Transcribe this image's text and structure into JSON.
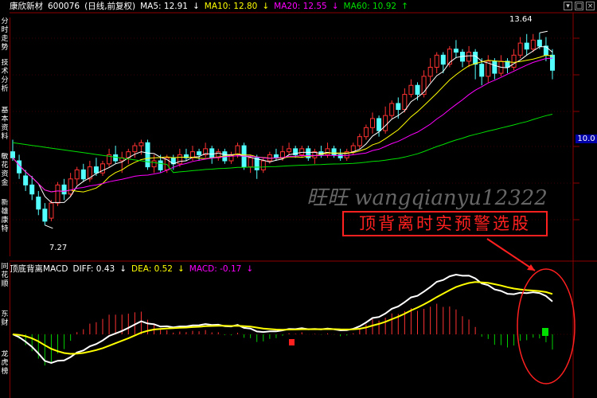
{
  "main_header": {
    "name": "康欣新材",
    "code": "600076",
    "period": "(日线,前复权)",
    "ma5": "MA5: 12.91",
    "ma10": "MA10: 12.80",
    "ma20": "MA20: 12.55",
    "ma60": "MA60: 10.92"
  },
  "macd_header": {
    "title": "顶底背离MACD",
    "diff": "DIFF: 0.43",
    "dea": "DEA: 0.52",
    "macd": "MACD: -0.17"
  },
  "left_tabs": [
    "分时走势",
    "技术分析",
    "基本资料",
    "敏花资金",
    "新雄康特"
  ],
  "left_tabs_lower": [
    "同花顺",
    "东财",
    "龙虎榜"
  ],
  "watermark": "旺旺 wangqianyu12322",
  "annotation": "顶背离时实预警选股",
  "price_labels": {
    "high": "13.64",
    "low": "7.27",
    "current": "10.0"
  },
  "colors": {
    "up": "#ff3232",
    "down": "#54ffff",
    "ma5": "#ffffff",
    "ma10": "#ffff00",
    "ma20": "#ff00ff",
    "ma60": "#00e000",
    "grid": "#8b0000",
    "annotation": "#ff2020"
  },
  "chart_data": {
    "type": "candlestick",
    "ylim": [
      6.5,
      14.2
    ],
    "candles": [
      [
        9.7,
        9.5,
        10.1,
        9.4
      ],
      [
        9.4,
        9.0,
        9.6,
        8.8
      ],
      [
        8.9,
        8.6,
        9.1,
        8.4
      ],
      [
        8.6,
        8.3,
        8.9,
        8.1
      ],
      [
        8.2,
        7.8,
        8.4,
        7.6
      ],
      [
        7.8,
        7.4,
        8.0,
        7.27
      ],
      [
        7.5,
        8.0,
        8.1,
        7.4
      ],
      [
        8.0,
        8.6,
        8.7,
        7.9
      ],
      [
        8.6,
        8.3,
        8.8,
        8.1
      ],
      [
        8.3,
        8.8,
        9.0,
        8.2
      ],
      [
        8.8,
        9.1,
        9.2,
        8.6
      ],
      [
        9.1,
        8.8,
        9.3,
        8.7
      ],
      [
        8.8,
        9.2,
        9.4,
        8.7
      ],
      [
        9.2,
        9.0,
        9.5,
        8.9
      ],
      [
        9.0,
        9.3,
        9.4,
        8.9
      ],
      [
        9.3,
        9.6,
        9.8,
        9.2
      ],
      [
        9.6,
        9.4,
        9.9,
        9.3
      ],
      [
        9.4,
        9.5,
        9.7,
        9.0
      ],
      [
        9.5,
        9.7,
        9.8,
        9.3
      ],
      [
        9.7,
        9.9,
        10.0,
        9.5
      ],
      [
        9.9,
        10.0,
        10.1,
        9.6
      ],
      [
        10.0,
        9.2,
        10.1,
        9.1
      ],
      [
        9.2,
        9.4,
        9.6,
        9.0
      ],
      [
        9.4,
        9.1,
        9.6,
        9.0
      ],
      [
        9.1,
        9.5,
        9.6,
        9.0
      ],
      [
        9.5,
        9.3,
        9.6,
        9.1
      ],
      [
        9.3,
        9.6,
        9.8,
        9.2
      ],
      [
        9.6,
        9.5,
        9.8,
        9.4
      ],
      [
        9.5,
        9.7,
        9.9,
        9.4
      ],
      [
        9.7,
        9.6,
        9.8,
        9.4
      ],
      [
        9.6,
        9.8,
        10.0,
        9.5
      ],
      [
        9.8,
        9.5,
        9.9,
        9.3
      ],
      [
        9.5,
        9.7,
        9.8,
        9.4
      ],
      [
        9.7,
        9.4,
        9.8,
        9.3
      ],
      [
        9.4,
        9.6,
        9.7,
        9.3
      ],
      [
        9.6,
        9.9,
        10.0,
        9.5
      ],
      [
        9.9,
        9.2,
        10.0,
        9.1
      ],
      [
        9.2,
        9.5,
        9.6,
        9.0
      ],
      [
        9.5,
        9.1,
        9.6,
        8.8
      ],
      [
        9.1,
        9.4,
        9.5,
        9.0
      ],
      [
        9.4,
        9.6,
        9.7,
        9.3
      ],
      [
        9.6,
        9.5,
        9.8,
        9.4
      ],
      [
        9.5,
        9.7,
        9.9,
        9.4
      ],
      [
        9.7,
        9.8,
        10.0,
        9.6
      ],
      [
        9.8,
        9.6,
        9.9,
        9.5
      ],
      [
        9.6,
        9.8,
        9.9,
        9.5
      ],
      [
        9.8,
        9.5,
        9.9,
        9.4
      ],
      [
        9.5,
        9.7,
        9.8,
        9.3
      ],
      [
        9.7,
        9.6,
        9.9,
        9.5
      ],
      [
        9.6,
        9.8,
        10.0,
        9.5
      ],
      [
        9.8,
        9.6,
        9.9,
        9.5
      ],
      [
        9.6,
        9.5,
        9.8,
        9.4
      ],
      [
        9.5,
        9.7,
        9.8,
        9.4
      ],
      [
        9.7,
        9.9,
        10.0,
        9.6
      ],
      [
        9.9,
        10.2,
        10.3,
        9.8
      ],
      [
        10.2,
        10.5,
        10.6,
        10.1
      ],
      [
        10.5,
        10.8,
        11.0,
        10.3
      ],
      [
        10.8,
        10.4,
        10.9,
        10.2
      ],
      [
        10.4,
        10.9,
        11.2,
        10.3
      ],
      [
        10.9,
        11.3,
        11.4,
        10.8
      ],
      [
        11.3,
        11.1,
        11.5,
        10.8
      ],
      [
        11.1,
        11.6,
        11.8,
        11.0
      ],
      [
        11.6,
        11.9,
        12.1,
        11.5
      ],
      [
        11.9,
        11.6,
        12.0,
        11.4
      ],
      [
        11.6,
        12.2,
        12.4,
        11.5
      ],
      [
        12.2,
        12.5,
        12.8,
        12.0
      ],
      [
        12.5,
        12.9,
        13.0,
        12.3
      ],
      [
        12.9,
        12.6,
        13.0,
        12.3
      ],
      [
        12.6,
        13.1,
        13.2,
        12.5
      ],
      [
        13.1,
        13.0,
        13.4,
        12.8
      ],
      [
        13.0,
        12.7,
        13.1,
        12.5
      ],
      [
        12.7,
        13.0,
        13.2,
        12.5
      ],
      [
        13.0,
        12.6,
        13.1,
        12.1
      ],
      [
        12.6,
        12.2,
        12.8,
        11.9
      ],
      [
        12.2,
        12.7,
        12.9,
        12.0
      ],
      [
        12.7,
        12.3,
        12.8,
        12.1
      ],
      [
        12.3,
        12.7,
        12.9,
        12.2
      ],
      [
        12.7,
        12.5,
        12.8,
        12.3
      ],
      [
        12.5,
        12.9,
        13.1,
        12.4
      ],
      [
        12.9,
        13.3,
        13.5,
        12.8
      ],
      [
        13.3,
        13.1,
        13.6,
        12.9
      ],
      [
        13.1,
        13.4,
        13.6,
        13.0
      ],
      [
        13.4,
        13.2,
        13.64,
        13.1
      ],
      [
        13.2,
        12.9,
        13.5,
        12.7
      ],
      [
        12.9,
        12.4,
        13.1,
        12.1
      ]
    ],
    "ma60_start": 10.0,
    "macd": {
      "diff_end": 0.43,
      "dea_end": 0.52,
      "macd_end": -0.17
    }
  }
}
